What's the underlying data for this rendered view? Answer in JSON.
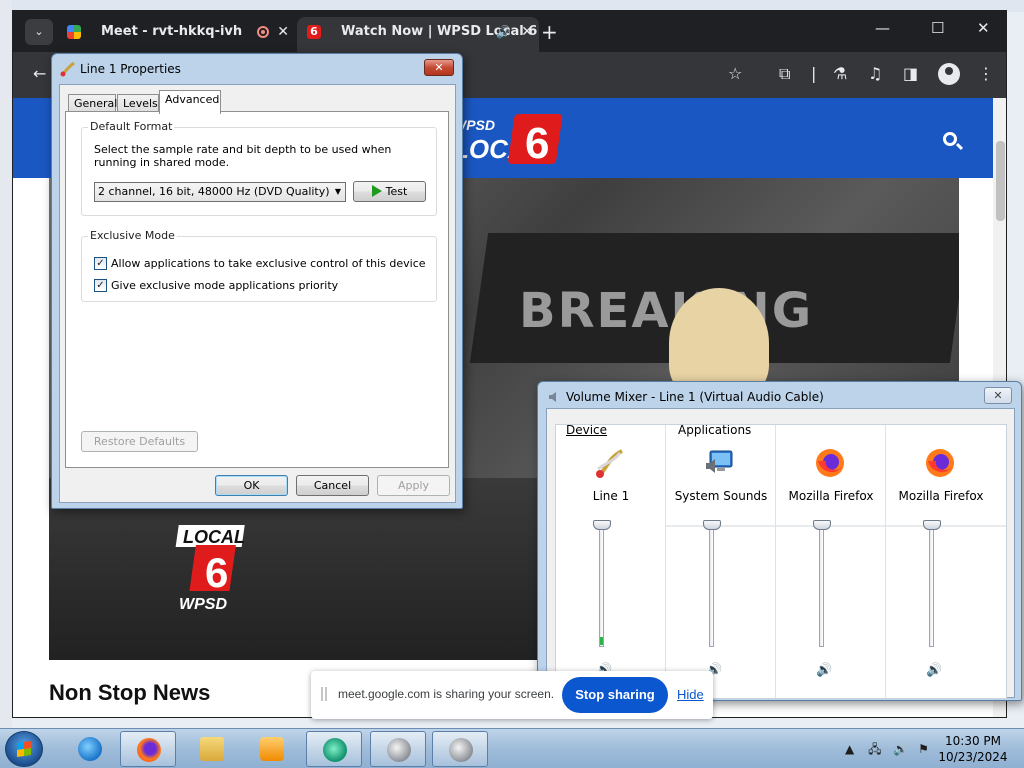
{
  "browser": {
    "tabs": [
      {
        "title": "Meet - rvt-hkkq-ivh",
        "favicon": "google-meet-icon"
      },
      {
        "title": "Watch Now | WPSD Local 6",
        "favicon": "wpsd-6-icon",
        "audio": true
      }
    ],
    "site": {
      "logo_text_top": "WPSD",
      "logo_text_main": "LOCAL",
      "logo_number": "6",
      "video_logo_top": "LOCAL",
      "video_logo_num": "6",
      "video_logo_bottom": "WPSD",
      "video_wall_text": "BREAKING",
      "headline": "Non Stop News",
      "header_color": "#1b57c2"
    }
  },
  "properties_dialog": {
    "title": "Line 1 Properties",
    "tabs": [
      "General",
      "Levels",
      "Advanced"
    ],
    "active_tab": "Advanced",
    "default_format": {
      "label": "Default Format",
      "description": "Select the sample rate and bit depth to be used when running in shared mode.",
      "selected": "2 channel, 16 bit, 48000 Hz (DVD Quality)",
      "test_label": "Test"
    },
    "exclusive_mode": {
      "label": "Exclusive Mode",
      "options": [
        {
          "label": "Allow applications to take exclusive control of this device",
          "checked": true
        },
        {
          "label": "Give exclusive mode applications priority",
          "checked": true
        }
      ]
    },
    "restore_label": "Restore Defaults",
    "ok_label": "OK",
    "cancel_label": "Cancel",
    "apply_label": "Apply"
  },
  "volume_mixer": {
    "title": "Volume Mixer - Line 1 (Virtual Audio Cable)",
    "device_label": "Device",
    "applications_label": "Applications",
    "columns": [
      {
        "name": "Line 1",
        "icon": "audio-cable-icon",
        "level": 1.0
      },
      {
        "name": "System Sounds",
        "icon": "system-sounds-icon",
        "level": 1.0
      },
      {
        "name": "Mozilla Firefox",
        "icon": "firefox-icon",
        "level": 1.0
      },
      {
        "name": "Mozilla Firefox",
        "icon": "firefox-icon",
        "level": 1.0
      }
    ]
  },
  "share_bar": {
    "message": "meet.google.com is sharing your screen.",
    "stop_label": "Stop sharing",
    "hide_label": "Hide"
  },
  "taskbar": {
    "apps": [
      "internet-explorer-icon",
      "firefox-icon",
      "file-explorer-icon",
      "media-player-icon",
      "app-icon",
      "speaker-icon",
      "speaker-icon"
    ],
    "time": "10:30 PM",
    "date": "10/23/2024"
  }
}
